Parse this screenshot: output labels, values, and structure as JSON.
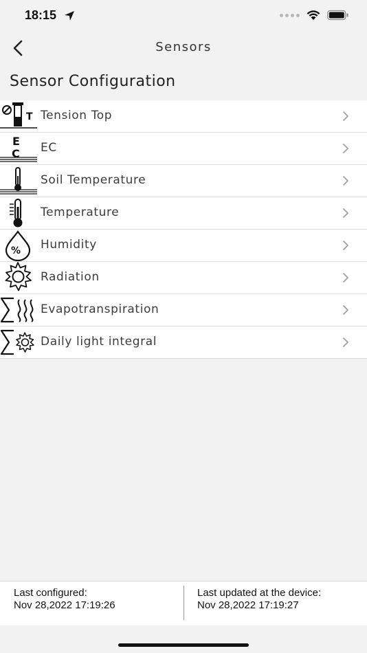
{
  "status_bar": {
    "time": "18:15",
    "icons": [
      "location-arrow-icon",
      "cellular-signal-icon",
      "wifi-icon",
      "battery-icon"
    ]
  },
  "nav": {
    "title": "Sensors",
    "back_icon": "chevron-left-icon"
  },
  "section": {
    "title": "Sensor Configuration"
  },
  "sensors": [
    {
      "label": "Tension Top",
      "icon": "tension-top-icon"
    },
    {
      "label": "EC",
      "icon": "ec-icon"
    },
    {
      "label": "Soil Temperature",
      "icon": "soil-temperature-icon"
    },
    {
      "label": "Temperature",
      "icon": "thermometer-icon"
    },
    {
      "label": "Humidity",
      "icon": "humidity-drop-icon"
    },
    {
      "label": "Radiation",
      "icon": "sun-icon"
    },
    {
      "label": "Evapotranspiration",
      "icon": "evapotranspiration-icon"
    },
    {
      "label": "Daily light integral",
      "icon": "daily-light-integral-icon"
    }
  ],
  "footer": {
    "last_configured_label": "Last configured:",
    "last_configured_value": "Nov 28,2022 17:19:26",
    "last_updated_label": "Last updated at the device:",
    "last_updated_value": "Nov 28,2022 17:19:27"
  },
  "colors": {
    "background": "#f2f2f2",
    "row_background": "#ffffff",
    "separator": "#dedede",
    "chevron": "#a0a0a0",
    "text": "#3c3c3c"
  }
}
